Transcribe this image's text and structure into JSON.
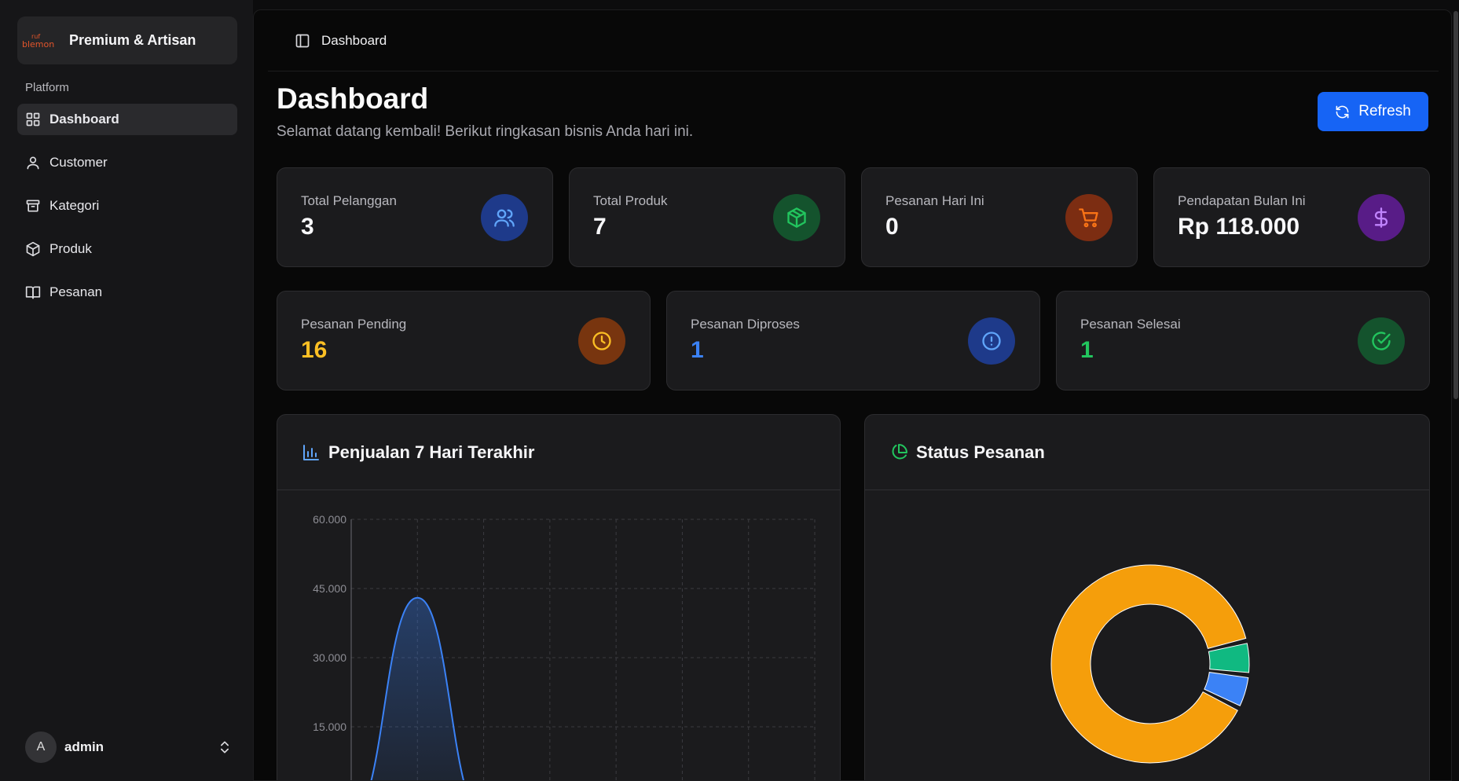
{
  "brand": {
    "name": "Premium & Artisan",
    "logo_text_top": "ruf",
    "logo_text_bottom": "blemon"
  },
  "sidebar": {
    "section_label": "Platform",
    "items": [
      {
        "label": "Dashboard",
        "icon": "grid-icon",
        "active": true
      },
      {
        "label": "Customer",
        "icon": "users-icon"
      },
      {
        "label": "Kategori",
        "icon": "archive-icon"
      },
      {
        "label": "Produk",
        "icon": "box-icon"
      },
      {
        "label": "Pesanan",
        "icon": "book-icon"
      }
    ],
    "user": {
      "initial": "A",
      "name": "admin"
    }
  },
  "header": {
    "breadcrumb": "Dashboard"
  },
  "page": {
    "title": "Dashboard",
    "subtitle": "Selamat datang kembali! Berikut ringkasan bisnis Anda hari ini.",
    "refresh_label": "Refresh"
  },
  "stats": [
    {
      "label": "Total Pelanggan",
      "value": "3",
      "icon": "users-icon",
      "color": "#60a5fa",
      "bg": "#1e3a8a"
    },
    {
      "label": "Total Produk",
      "value": "7",
      "icon": "box-icon",
      "color": "#22c55e",
      "bg": "#14532d"
    },
    {
      "label": "Pesanan Hari Ini",
      "value": "0",
      "icon": "cart-icon",
      "color": "#f97316",
      "bg": "#7c2d12"
    },
    {
      "label": "Pendapatan Bulan Ini",
      "value": "Rp 118.000",
      "icon": "dollar-icon",
      "color": "#c084fc",
      "bg": "#581c87"
    }
  ],
  "order_stats": [
    {
      "label": "Pesanan Pending",
      "value": "16",
      "icon": "clock-icon",
      "color": "#fbbf24",
      "bg": "#78350f",
      "value_color": "#fbbf24"
    },
    {
      "label": "Pesanan Diproses",
      "value": "1",
      "icon": "alert-circle-icon",
      "color": "#60a5fa",
      "bg": "#1e3a8a",
      "value_color": "#3b82f6"
    },
    {
      "label": "Pesanan Selesai",
      "value": "1",
      "icon": "check-circle-icon",
      "color": "#22c55e",
      "bg": "#14532d",
      "value_color": "#22c55e"
    }
  ],
  "panels": {
    "sales_title": "Penjualan 7 Hari Terakhir",
    "status_title": "Status Pesanan"
  },
  "chart_data": [
    {
      "type": "area",
      "title": "Penjualan 7 Hari Terakhir",
      "ylim": [
        0,
        60000
      ],
      "yticks": [
        "60.000",
        "45.000",
        "30.000",
        "15.000"
      ],
      "ytick_values": [
        60000,
        45000,
        30000,
        15000
      ],
      "x": [
        0,
        1,
        2,
        3,
        4,
        5,
        6
      ],
      "values": [
        0,
        43000,
        0,
        0,
        0,
        0,
        0
      ],
      "grid": true,
      "color": "#3b82f6"
    },
    {
      "type": "pie",
      "title": "Status Pesanan",
      "slices": [
        {
          "value": 16,
          "color": "#f59e0b"
        },
        {
          "value": 1,
          "color": "#10b981"
        },
        {
          "value": 1,
          "color": "#3b82f6"
        }
      ]
    }
  ]
}
